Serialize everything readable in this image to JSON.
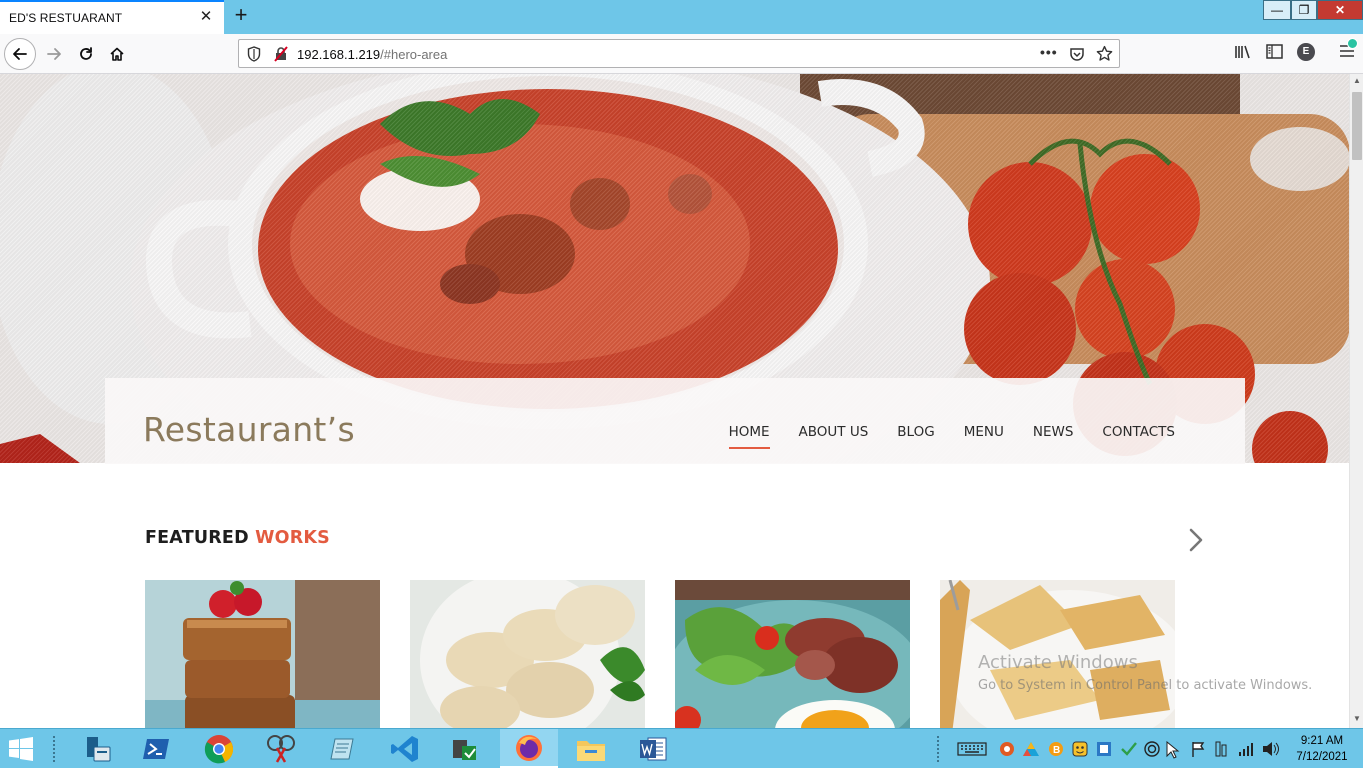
{
  "browser": {
    "tab_title": "ED'S RESTUARANT",
    "tab_close": "✕",
    "new_tab": "+",
    "url_host": "192.168.1.219",
    "url_path": "/#hero-area",
    "url_more": "•••",
    "account_initial": "E",
    "window": {
      "minimize": "—",
      "maximize": "❐",
      "close": "✕"
    }
  },
  "site": {
    "logo": "Restaurant’s",
    "menu": [
      {
        "label": "HOME",
        "active": true
      },
      {
        "label": "ABOUT US",
        "active": false
      },
      {
        "label": "BLOG",
        "active": false
      },
      {
        "label": "MENU",
        "active": false
      },
      {
        "label": "NEWS",
        "active": false
      },
      {
        "label": "CONTACTS",
        "active": false
      }
    ],
    "featured": {
      "title_main": "FEATURED",
      "title_accent": "WORKS"
    },
    "accent_color": "#e35b40",
    "logo_color": "#8b7a5c"
  },
  "watermark": {
    "line1": "Activate Windows",
    "line2": "Go to System in Control Panel to activate Windows."
  },
  "taskbar": {
    "time": "9:21 AM",
    "date": "7/12/2021",
    "apps": [
      "start-icon",
      "server-manager-icon",
      "powershell-icon",
      "chrome-icon",
      "snipping-tool-icon",
      "notepad-icon",
      "vscode-icon",
      "network-tool-icon",
      "firefox-icon",
      "file-explorer-icon",
      "word-icon"
    ]
  },
  "colors": {
    "chrome_blue": "#6ec6e8",
    "tab_accent": "#0a84ff"
  }
}
